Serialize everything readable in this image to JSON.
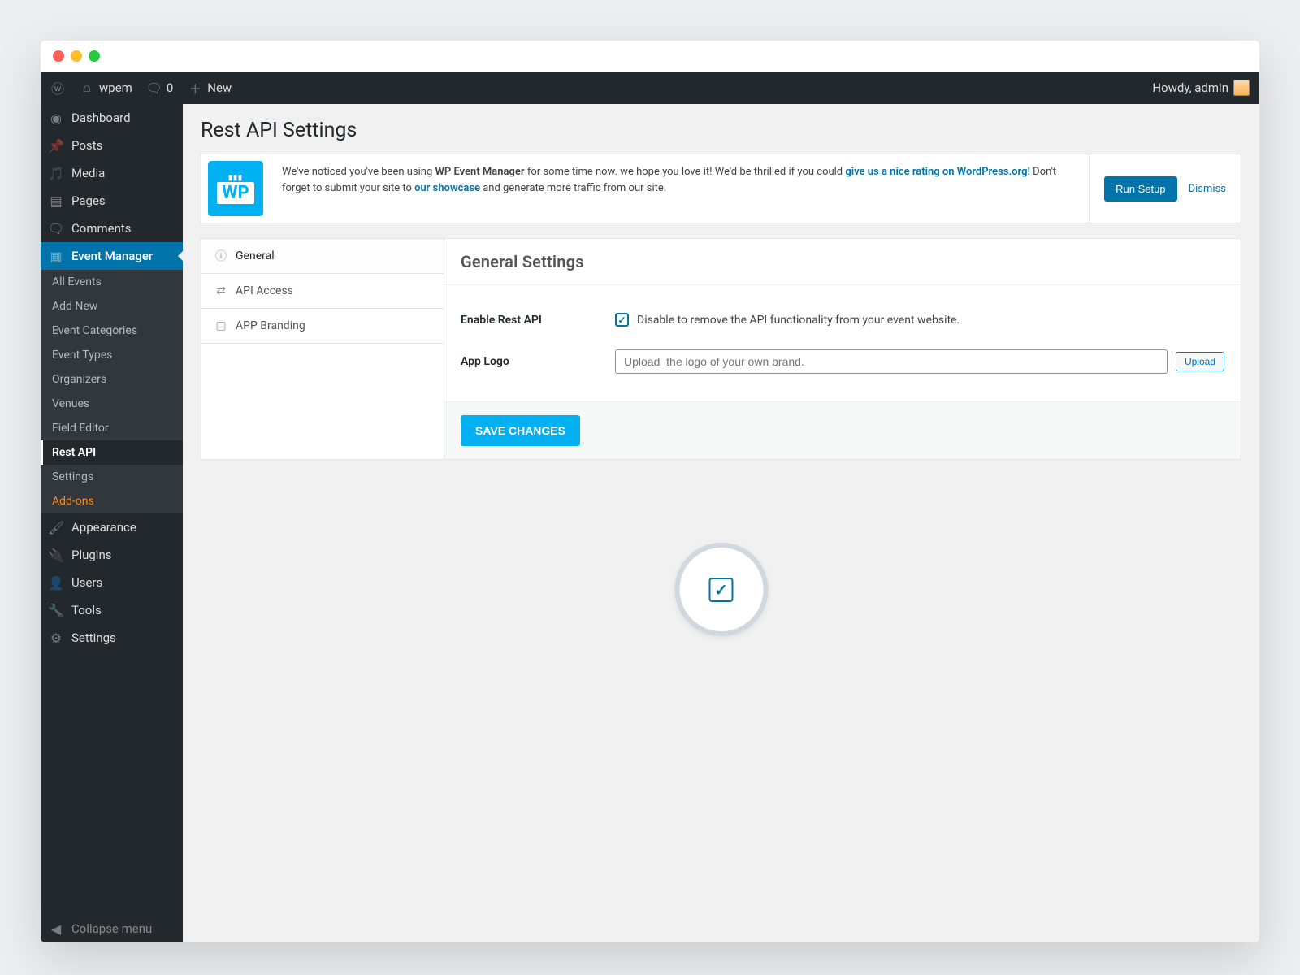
{
  "topbar": {
    "site_name": "wpem",
    "comment_count": "0",
    "new_label": "New",
    "greeting": "Howdy, admin"
  },
  "sidebar": {
    "items": [
      {
        "icon": "dashboard",
        "label": "Dashboard"
      },
      {
        "icon": "pin",
        "label": "Posts"
      },
      {
        "icon": "media",
        "label": "Media"
      },
      {
        "icon": "page",
        "label": "Pages"
      },
      {
        "icon": "comment",
        "label": "Comments"
      },
      {
        "icon": "calendar",
        "label": "Event Manager",
        "active": true
      }
    ],
    "submenu": [
      "All Events",
      "Add New",
      "Event Categories",
      "Event Types",
      "Organizers",
      "Venues",
      "Field Editor",
      "Rest API",
      "Settings",
      "Add-ons"
    ],
    "sub_selected": "Rest API",
    "sub_addon": "Add-ons",
    "after": [
      {
        "icon": "brush",
        "label": "Appearance"
      },
      {
        "icon": "plug",
        "label": "Plugins"
      },
      {
        "icon": "user",
        "label": "Users"
      },
      {
        "icon": "wrench",
        "label": "Tools"
      },
      {
        "icon": "sliders",
        "label": "Settings"
      }
    ],
    "collapse_label": "Collapse menu"
  },
  "page": {
    "title": "Rest API Settings"
  },
  "notice": {
    "text_before": "We've noticed you've been using ",
    "product": "WP Event Manager",
    "text_mid": " for some time now. we hope you love it! We'd be thrilled if you could ",
    "link1": "give us a nice rating on WordPress.org!",
    "text_after1": " Don't forget to submit your site to ",
    "link2": "our showcase",
    "text_after2": " and generate more traffic from our site.",
    "run_setup": "Run Setup",
    "dismiss": "Dismiss"
  },
  "tabs": [
    {
      "icon": "cog",
      "label": "General"
    },
    {
      "icon": "swap",
      "label": "API Access"
    },
    {
      "icon": "phone",
      "label": "APP Branding"
    }
  ],
  "panel": {
    "header": "General Settings",
    "row1_label": "Enable Rest API",
    "row1_desc": "Disable to remove the API functionality from your event website.",
    "row2_label": "App Logo",
    "upload_placeholder": "Upload  the logo of your own brand.",
    "upload_btn": "Upload",
    "save_btn": "SAVE CHANGES"
  }
}
